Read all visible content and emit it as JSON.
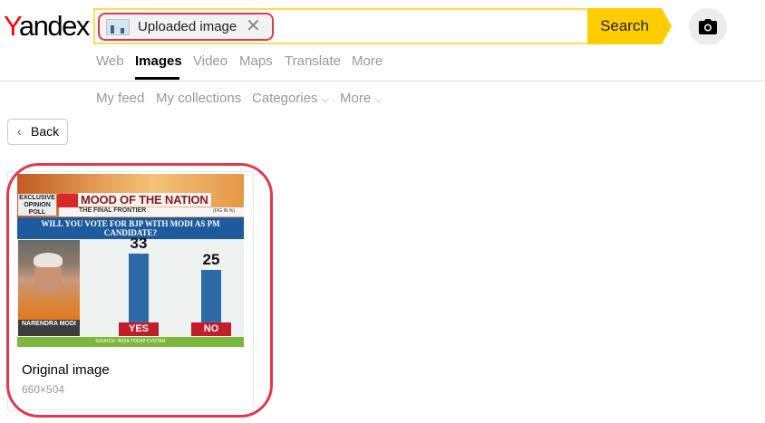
{
  "brand": {
    "first_letter": "Y",
    "rest": "andex"
  },
  "search": {
    "chip_label": "Uploaded image",
    "button_label": "Search"
  },
  "nav": {
    "items": [
      "Web",
      "Images",
      "Video",
      "Maps",
      "Translate",
      "More"
    ],
    "active": "Images"
  },
  "subnav": {
    "items": [
      "My feed",
      "My collections",
      "Categories",
      "More"
    ],
    "dropdown_chevron": "⌵"
  },
  "back_label": "Back",
  "result": {
    "title": "Original image",
    "size": "660×504",
    "thumbnail": {
      "exclusive_tag": "EXCLUSIVE OPINION POLL",
      "headline": "MOOD OF THE NATION",
      "subheadline": "THE FINAL FRONTIER",
      "figure_note": "(FIG IN %)",
      "question": "WILL YOU VOTE FOR BJP WITH MODI AS PM CANDIDATE?",
      "person": "NARENDRA MODI",
      "source": "SOURCE: INDIA TODAY-CVOTER"
    }
  },
  "chart_data": {
    "type": "bar",
    "categories": [
      "YES",
      "NO"
    ],
    "values": [
      33,
      25
    ],
    "ylim": [
      0,
      40
    ]
  },
  "colors": {
    "accent": "#ffcc00",
    "highlight": "#e0394f",
    "brand_red": "#ff0000"
  }
}
